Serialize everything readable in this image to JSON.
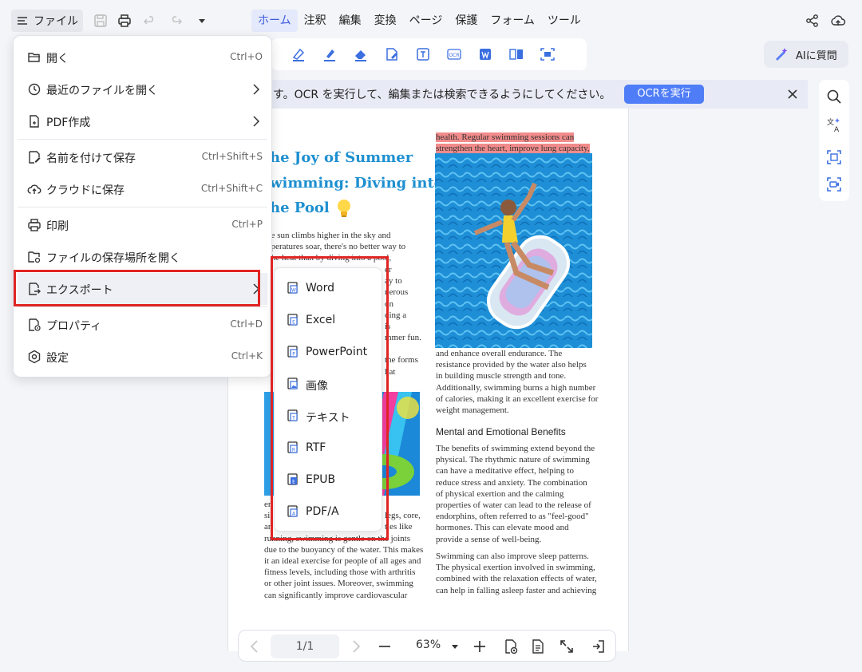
{
  "topbar": {
    "file_label": "ファイル",
    "menu_tabs": [
      "ホーム",
      "注釈",
      "編集",
      "変換",
      "ページ",
      "保護",
      "フォーム",
      "ツール"
    ],
    "active_tab": "ホーム"
  },
  "ai_button": {
    "label": "AIに質問"
  },
  "ocr_bar": {
    "message": "す。OCR を実行して、編集または検索できるようにしてください。",
    "button_label": "OCRを実行"
  },
  "file_menu": {
    "items": [
      {
        "label": "開く",
        "shortcut": "Ctrl+O",
        "icon": "folder-open-icon"
      },
      {
        "label": "最近のファイルを開く",
        "shortcut": "",
        "icon": "clock-icon"
      },
      {
        "label": "PDF作成",
        "shortcut": "",
        "icon": "file-plus-icon"
      },
      {
        "label": "名前を付けて保存",
        "shortcut": "Ctrl+Shift+S",
        "icon": "save-as-icon"
      },
      {
        "label": "クラウドに保存",
        "shortcut": "Ctrl+Shift+C",
        "icon": "cloud-upload-icon"
      },
      {
        "label": "印刷",
        "shortcut": "Ctrl+P",
        "icon": "print-icon"
      },
      {
        "label": "ファイルの保存場所を開く",
        "shortcut": "",
        "icon": "folder-location-icon"
      },
      {
        "label": "エクスポート",
        "shortcut": "",
        "icon": "export-icon"
      },
      {
        "label": "プロパティ",
        "shortcut": "Ctrl+D",
        "icon": "properties-icon"
      },
      {
        "label": "設定",
        "shortcut": "Ctrl+K",
        "icon": "settings-icon"
      }
    ]
  },
  "export_menu": {
    "items": [
      "Word",
      "Excel",
      "PowerPoint",
      "画像",
      "テキスト",
      "RTF",
      "EPUB",
      "PDF/A"
    ]
  },
  "document": {
    "title_lines": [
      "he Joy of Summer",
      "wimming: Diving into",
      "he Pool"
    ],
    "left_col": [
      "the sun climbs higher in the sky and",
      "mperatures soar, there's no better way to",
      "t the heat than by diving into a pool,"
    ],
    "left_col_fragments": [
      "er",
      "ay to",
      "nerous",
      "on",
      "ding a",
      "is",
      "mmer fun.",
      "the forms",
      "hat"
    ],
    "left_bottom": [
      "er",
      "si",
      "ar",
      "running, swimming is gentle on the joints",
      "due to the buoyancy of the water. This makes",
      "it an ideal exercise for people of all ages and",
      "fitness levels, including those with arthritis",
      "or other joint issues. Moreover, swimming",
      "can significantly improve cardiovascular"
    ],
    "left_bottom_fragments": [
      "legs, core,",
      "ties like"
    ],
    "right_highlight": [
      "health. Regular swimming sessions can",
      "strengthen the heart, improve lung capacity,"
    ],
    "right_col_1": [
      "and enhance overall endurance. The",
      "resistance provided by the water also helps",
      "in building muscle strength and tone.",
      "Additionally, swimming burns a high number",
      "of calories, making it an excellent exercise for",
      "weight management."
    ],
    "section_heading": "Mental and Emotional Benefits",
    "right_col_2": [
      "The benefits of swimming extend beyond the",
      "physical. The rhythmic nature of swimming",
      "can have a meditative effect, helping to",
      "reduce stress and anxiety. The combination",
      "of physical exertion and the calming",
      "properties of water can lead to the release of",
      "endorphins, often referred to as \"feel-good\"",
      "hormones. This can elevate mood and",
      "provide a sense of well-being."
    ],
    "right_col_3": [
      "Swimming can also improve sleep patterns.",
      "The physical exertion involved in swimming,",
      "combined with the relaxation effects of water,",
      "can help in falling asleep faster and achieving"
    ]
  },
  "bottombar": {
    "page_indicator": "1/1",
    "zoom": "63%"
  },
  "colors": {
    "accent": "#4f7cf7",
    "highlight_box": "#e02424",
    "title_blue": "#1d8fd0",
    "text_highlight": "#f28b8b"
  }
}
